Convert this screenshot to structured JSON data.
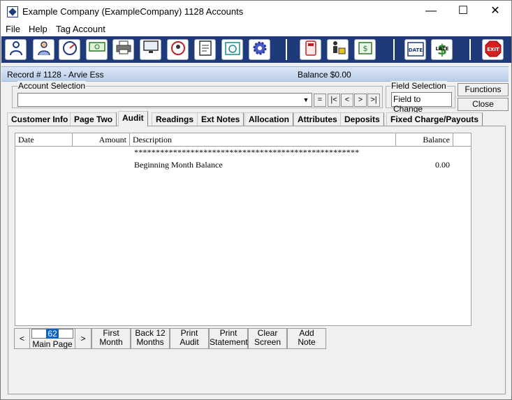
{
  "window": {
    "title": "Example Company (ExampleCompany)  1128 Accounts",
    "minimize": "—",
    "maximize": "☐",
    "close": "✕"
  },
  "menu": [
    "File",
    "Help",
    "Tag Account"
  ],
  "toolbar": {
    "icons": [
      "person-icon",
      "badge-person-icon",
      "gauge-icon",
      "money-icon",
      "printer-icon",
      "monitor-icon",
      "map-pin-icon",
      "invoice-icon",
      "calendar-clock-icon",
      "gear-icon",
      "calculator-icon",
      "worker-icon",
      "dollar-register-icon",
      "date-calendar-icon",
      "late-dollar-icon",
      "exit-stop-icon"
    ],
    "date_label": "DATE",
    "late_label": "LATE",
    "exit_label": "EXIT"
  },
  "record": {
    "label": "Record # 1128 - Arvie Ess",
    "balance": "Balance  $0.00"
  },
  "account_selection": {
    "legend": "Account Selection",
    "value": "",
    "nav": [
      "=",
      "|<",
      "<",
      ">",
      ">|"
    ]
  },
  "field_selection": {
    "legend": "Field Selection",
    "value": "Field to Change"
  },
  "side_buttons": {
    "functions": "Functions",
    "close": "Close"
  },
  "tabs": [
    "Customer Info",
    "Page Two",
    "Audit",
    "Readings",
    "Ext Notes",
    "Allocation",
    "Attributes",
    "Deposits",
    "Fixed Charge/Payouts"
  ],
  "active_tab": "Audit",
  "grid": {
    "columns": [
      "Date",
      "Amount",
      "Description",
      "Balance"
    ],
    "rows": [
      {
        "date": "",
        "amount": "",
        "description": "****************************************************",
        "balance": ""
      },
      {
        "date": "",
        "amount": "",
        "description": "Beginning Month Balance",
        "balance": "0.00"
      }
    ]
  },
  "pager": {
    "prev": "<",
    "next": ">",
    "page_number": "62",
    "page_label": "Main Page",
    "buttons": [
      {
        "line1": "First",
        "line2": "Month"
      },
      {
        "line1": "Back 12",
        "line2": "Months"
      },
      {
        "line1": "Print",
        "line2": "Audit"
      },
      {
        "line1": "Print",
        "line2": "Statement"
      },
      {
        "line1": "Clear",
        "line2": "Screen"
      },
      {
        "line1": "Add",
        "line2": "Note"
      }
    ]
  }
}
